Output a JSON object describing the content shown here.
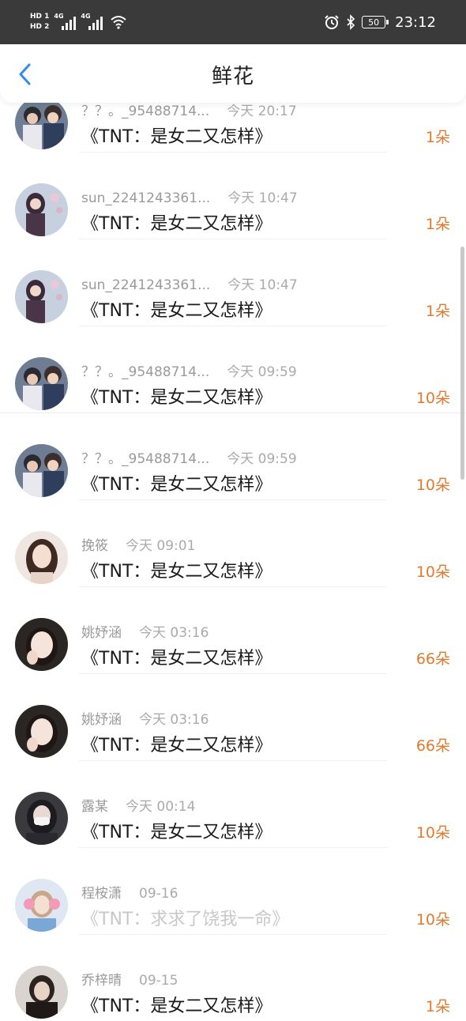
{
  "status_bar": {
    "hd1": "HD 1",
    "hd2": "HD 2",
    "net1": "4G",
    "net2": "4G",
    "battery": "50",
    "time": "23:12"
  },
  "header": {
    "title": "鲜花"
  },
  "colors": {
    "accent": "#e07a2e",
    "back_icon": "#2f8cf2"
  },
  "rows": [
    {
      "user": "？？。_95488714...",
      "time": "今天 20:17",
      "book": "《TNT：是女二又怎样》",
      "count": "1朵",
      "avatar": "two-boys-avatar"
    },
    {
      "user": "sun_2241243361...",
      "time": "今天 10:47",
      "book": "《TNT：是女二又怎样》",
      "count": "1朵",
      "avatar": "girl-stage-avatar"
    },
    {
      "user": "sun_2241243361...",
      "time": "今天 10:47",
      "book": "《TNT：是女二又怎样》",
      "count": "1朵",
      "avatar": "girl-stage-avatar"
    },
    {
      "user": "？？。_95488714...",
      "time": "今天 09:59",
      "book": "《TNT：是女二又怎样》",
      "count": "10朵",
      "avatar": "two-boys-avatar"
    },
    {
      "user": "？？。_95488714...",
      "time": "今天 09:59",
      "book": "《TNT：是女二又怎样》",
      "count": "10朵",
      "avatar": "two-boys-avatar"
    },
    {
      "user": "挽筱",
      "time": "今天 09:01",
      "book": "《TNT：是女二又怎样》",
      "count": "10朵",
      "avatar": "girl-portrait-avatar"
    },
    {
      "user": "姚妤涵",
      "time": "今天 03:16",
      "book": "《TNT：是女二又怎样》",
      "count": "66朵",
      "avatar": "girl-selfie-avatar"
    },
    {
      "user": "姚妤涵",
      "time": "今天 03:16",
      "book": "《TNT：是女二又怎样》",
      "count": "66朵",
      "avatar": "girl-selfie-avatar"
    },
    {
      "user": "露某",
      "time": "今天 00:14",
      "book": "《TNT：是女二又怎样》",
      "count": "10朵",
      "avatar": "masked-girl-avatar"
    },
    {
      "user": "程桉潇",
      "time": "09-16",
      "book": "《TNT：求求了饶我一命》",
      "count": "10朵",
      "avatar": "pink-headphones-avatar"
    },
    {
      "user": "乔梓晴",
      "time": "09-15",
      "book": "《TNT：是女二又怎样》",
      "count": "1朵",
      "avatar": "dark-portrait-avatar"
    }
  ]
}
